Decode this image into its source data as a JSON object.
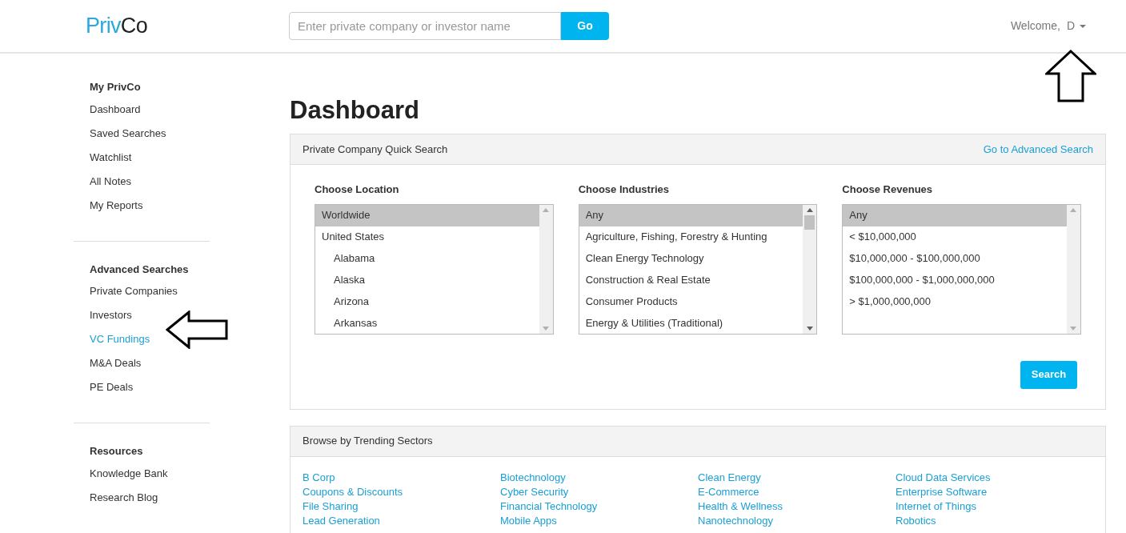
{
  "header": {
    "logo": {
      "part_1": "Priv",
      "part_2": "Co"
    },
    "search": {
      "placeholder": "Enter private company or investor name",
      "button": "Go"
    },
    "welcome": "Welcome,",
    "user": "D"
  },
  "sidebar": {
    "sections": [
      {
        "title": "My PrivCo",
        "items": [
          {
            "label": "Dashboard",
            "selected": false
          },
          {
            "label": "Saved Searches",
            "selected": false
          },
          {
            "label": "Watchlist",
            "selected": false
          },
          {
            "label": "All Notes",
            "selected": false
          },
          {
            "label": "My Reports",
            "selected": false
          }
        ]
      },
      {
        "title": "Advanced Searches",
        "items": [
          {
            "label": "Private Companies",
            "selected": false
          },
          {
            "label": "Investors",
            "selected": false
          },
          {
            "label": "VC Fundings",
            "selected": true
          },
          {
            "label": "M&A Deals",
            "selected": false
          },
          {
            "label": "PE Deals",
            "selected": false
          }
        ]
      },
      {
        "title": "Resources",
        "items": [
          {
            "label": "Knowledge Bank",
            "selected": false
          },
          {
            "label": "Research Blog",
            "selected": false
          }
        ]
      }
    ]
  },
  "page_title": "Dashboard",
  "quick_search": {
    "title": "Private Company Quick Search",
    "link": "Go to Advanced Search",
    "button": "Search",
    "lists": [
      {
        "label": "Choose Location",
        "options": [
          {
            "label": "Worldwide",
            "selected": true
          },
          {
            "label": "United States",
            "selected": false,
            "children": [
              {
                "label": "Alabama",
                "selected": false
              },
              {
                "label": "Alaska",
                "selected": false
              },
              {
                "label": "Arizona",
                "selected": false
              },
              {
                "label": "Arkansas",
                "selected": false
              }
            ]
          }
        ]
      },
      {
        "label": "Choose Industries",
        "options": [
          {
            "label": "Any",
            "selected": true
          },
          {
            "label": "Agriculture, Fishing, Forestry & Hunting",
            "selected": false
          },
          {
            "label": "Clean Energy Technology",
            "selected": false
          },
          {
            "label": "Construction & Real Estate",
            "selected": false
          },
          {
            "label": "Consumer Products",
            "selected": false
          },
          {
            "label": "Energy & Utilities (Traditional)",
            "selected": false
          }
        ]
      },
      {
        "label": "Choose Revenues",
        "options": [
          {
            "label": "Any",
            "selected": true
          },
          {
            "label": "< $10,000,000",
            "selected": false
          },
          {
            "label": "$10,000,000 - $100,000,000",
            "selected": false
          },
          {
            "label": "$100,000,000 - $1,000,000,000",
            "selected": false
          },
          {
            "label": "> $1,000,000,000",
            "selected": false
          }
        ]
      }
    ]
  },
  "trending": {
    "title": "Browse by Trending Sectors",
    "sectors": [
      "B Corp",
      "Biotechnology",
      "Clean Energy",
      "Cloud Data Services",
      "Coupons & Discounts",
      "Cyber Security",
      "E-Commerce",
      "Enterprise Software",
      "File Sharing",
      "Financial Technology",
      "Health & Wellness",
      "Internet of Things",
      "Lead Generation",
      "Mobile Apps",
      "Nanotechnology",
      "Robotics"
    ]
  }
}
